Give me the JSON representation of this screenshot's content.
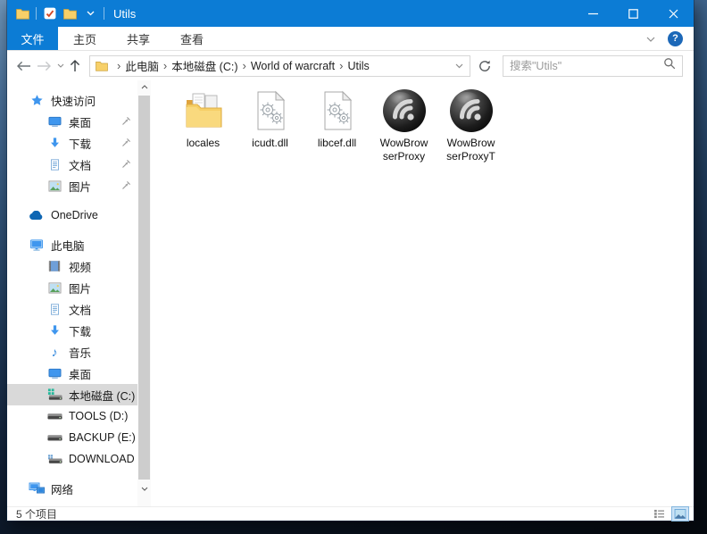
{
  "window": {
    "title": "Utils"
  },
  "menubar": {
    "file": "文件",
    "tabs": [
      "主页",
      "共享",
      "查看"
    ]
  },
  "addressbar": {
    "crumbs": [
      "此电脑",
      "本地磁盘 (C:)",
      "World of warcraft",
      "Utils"
    ],
    "search_placeholder": "搜索\"Utils\""
  },
  "sidebar": {
    "quick_access": "快速访问",
    "quick_items": [
      "桌面",
      "下载",
      "文档",
      "图片"
    ],
    "onedrive": "OneDrive",
    "this_pc": "此电脑",
    "pc_items": [
      "视频",
      "图片",
      "文档",
      "下载",
      "音乐",
      "桌面",
      "本地磁盘 (C:)",
      "TOOLS (D:)",
      "BACKUP (E:)",
      "DOWNLOAD (F:)"
    ],
    "network": "网络"
  },
  "files": [
    {
      "label": "locales",
      "type": "folder"
    },
    {
      "label": "icudt.dll",
      "type": "dll"
    },
    {
      "label": "libcef.dll",
      "type": "dll"
    },
    {
      "label": "WowBrowserProxy",
      "type": "app",
      "lines": [
        "WowBrow",
        "serProxy"
      ]
    },
    {
      "label": "WowBrowserProxyT",
      "type": "app",
      "lines": [
        "WowBrow",
        "serProxyT"
      ]
    }
  ],
  "statusbar": {
    "item_count": "5 个项目"
  },
  "colors": {
    "accent": "#0c7cd5",
    "selection": "#d9d9d9",
    "titlebar": "#0c7cd5"
  }
}
